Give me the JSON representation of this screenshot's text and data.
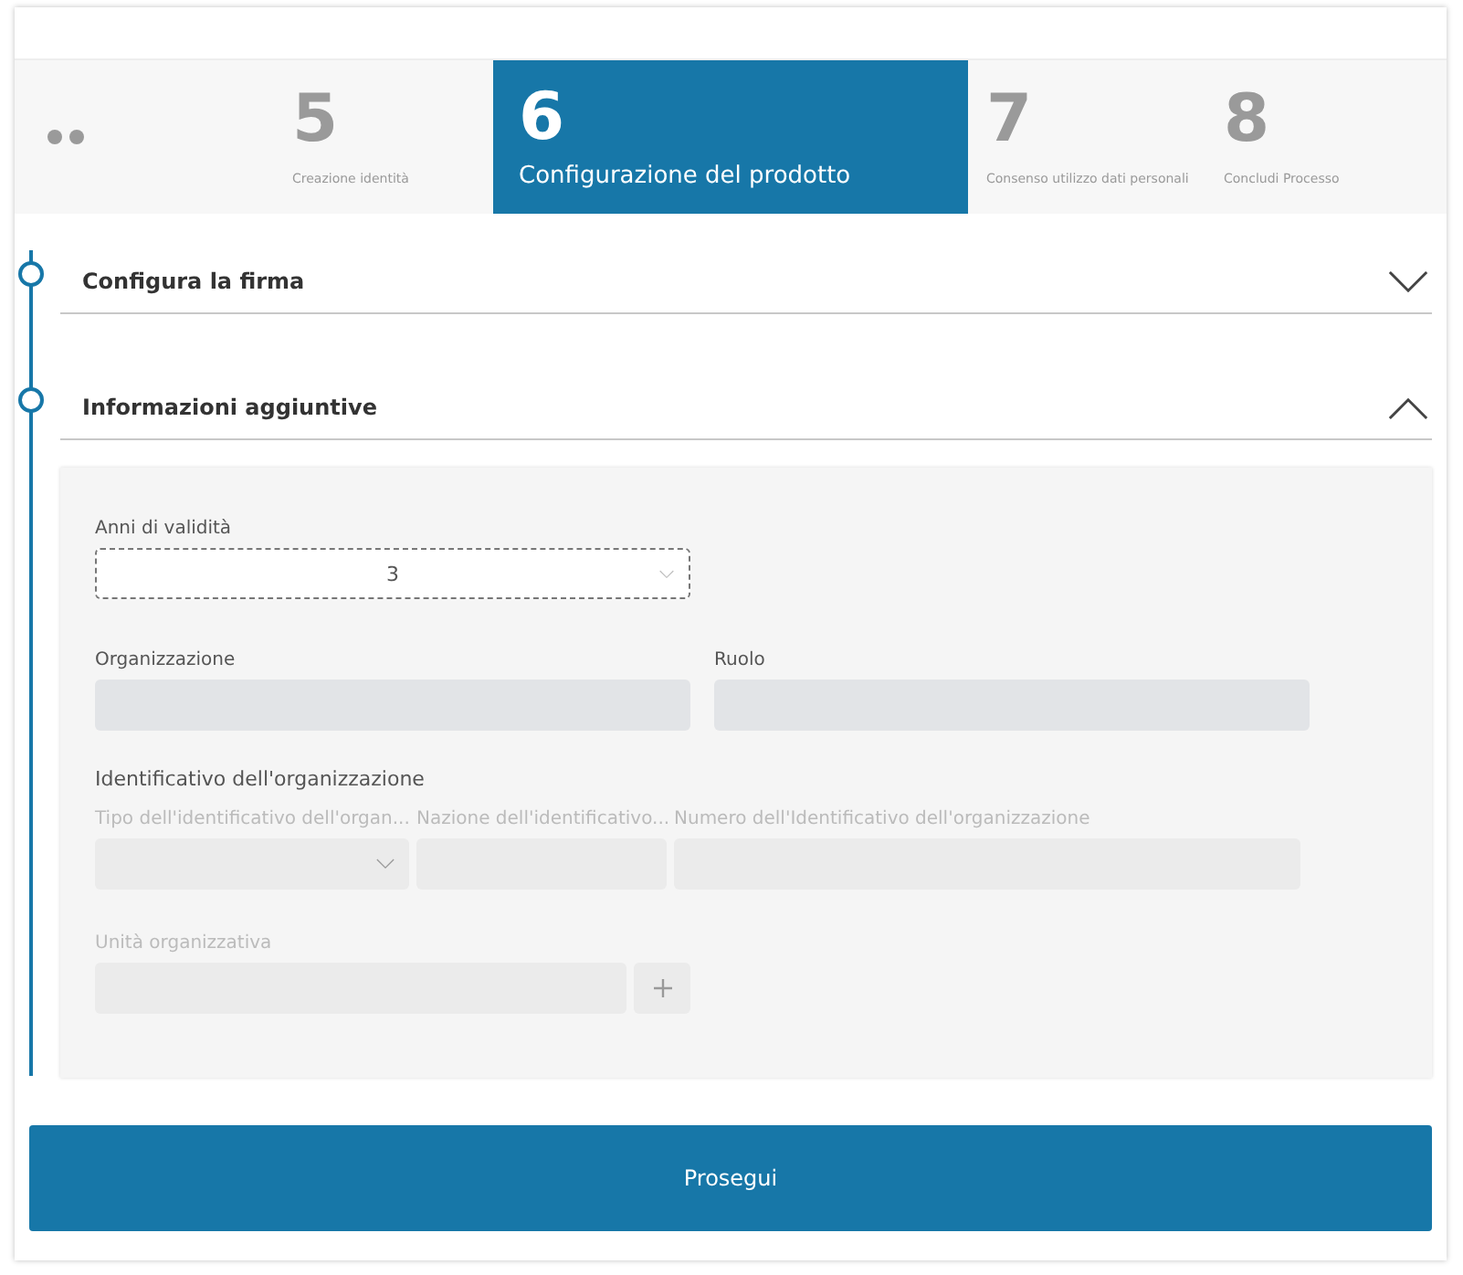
{
  "stepper": {
    "steps": [
      {
        "number": "5",
        "label": "Creazione identità",
        "selected": false
      },
      {
        "number": "6",
        "label": "Configurazione del prodotto",
        "selected": true
      },
      {
        "number": "7",
        "label": "Consenso utilizzo dati personali",
        "selected": false
      },
      {
        "number": "8",
        "label": "Concludi Processo",
        "selected": false
      }
    ]
  },
  "sections": [
    {
      "title": "Configura la firma",
      "expanded": false
    },
    {
      "title": "Informazioni aggiuntive",
      "expanded": true
    }
  ],
  "form": {
    "validity": {
      "label": "Anni di validità",
      "value": "3"
    },
    "organization": {
      "label": "Organizzazione",
      "disabled": true
    },
    "role": {
      "label": "Ruolo",
      "disabled": true
    },
    "identifier": {
      "title": "Identificativo dell'organizzazione",
      "fields": [
        {
          "label": "Tipo dell'identificativo dell'organ...",
          "kind": "select",
          "disabled": true
        },
        {
          "label": "Nazione dell'identificativo...",
          "kind": "text",
          "disabled": true
        },
        {
          "label": "Numero dell'Identificativo dell'organizzazione",
          "kind": "text",
          "disabled": true
        }
      ]
    },
    "unit": {
      "label": "Unità organizzativa",
      "disabled": true
    }
  },
  "primary_button": "Prosegui"
}
